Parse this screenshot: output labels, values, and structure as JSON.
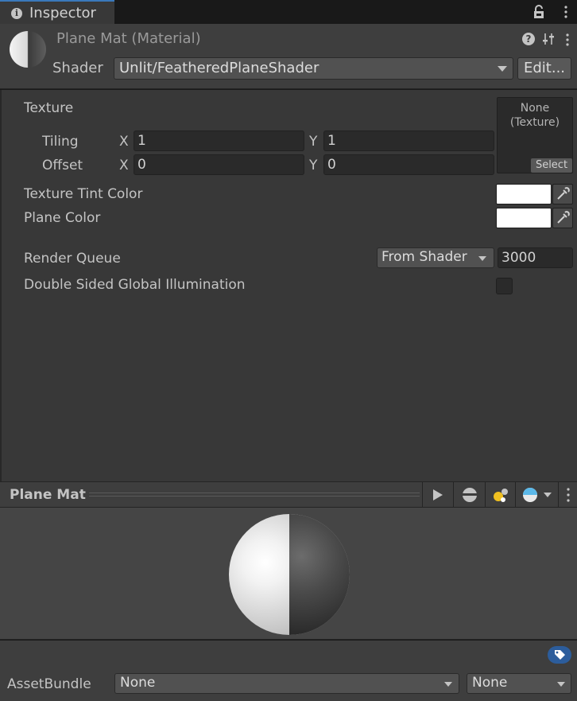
{
  "tab": {
    "label": "Inspector",
    "info_icon": "info-icon",
    "lock_icon": "lock-icon",
    "menu_icon": "kebab-menu-icon"
  },
  "header": {
    "title": "Plane Mat (Material)",
    "shader_label": "Shader",
    "shader_value": "Unlit/FeatheredPlaneShader",
    "edit_label": "Edit...",
    "help_icon_glyph": "?"
  },
  "properties": {
    "texture_label": "Texture",
    "tiling_label": "Tiling",
    "offset_label": "Offset",
    "x_axis": "X",
    "y_axis": "Y",
    "tiling_x": "1",
    "tiling_y": "1",
    "offset_x": "0",
    "offset_y": "0",
    "texture_slot_none": "None\n(Texture)",
    "texture_select": "Select",
    "tint_label": "Texture Tint Color",
    "tint_color": "#ffffff",
    "plane_color_label": "Plane Color",
    "plane_color": "#ffffff",
    "render_queue_label": "Render Queue",
    "render_queue_mode": "From Shader",
    "render_queue_value": "3000",
    "gi_label": "Double Sided Global Illumination",
    "gi_checked": false
  },
  "preview": {
    "title": "Plane Mat",
    "toolbar_icons": [
      "play-icon",
      "sphere-mesh-icon",
      "light-icon",
      "skybox-sphere-icon",
      "chevron-down-icon",
      "kebab-menu-icon"
    ]
  },
  "footer": {
    "label_icon": "tag-icon",
    "assetbundle_label": "AssetBundle",
    "bundle_name": "None",
    "bundle_variant": "None"
  },
  "colors": {
    "accent": "#3a79bb",
    "panel": "#383838",
    "header": "#3e3e3e",
    "field": "#2a2a2a"
  }
}
